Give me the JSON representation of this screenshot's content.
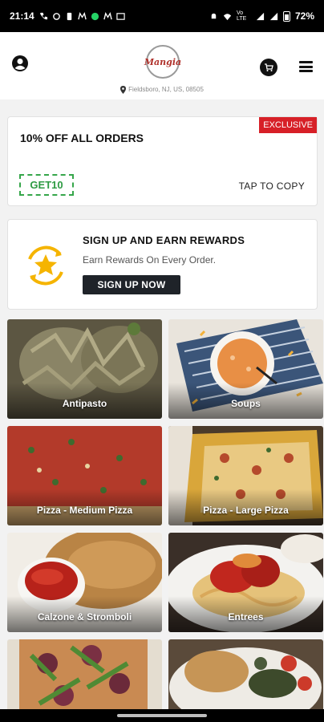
{
  "status_bar": {
    "time": "21:14",
    "battery": "72%",
    "network": "Vo LTE"
  },
  "header": {
    "logo_text": "Mangia",
    "location": "Fieldsboro, NJ, US, 08505"
  },
  "coupon": {
    "title": "10% OFF ALL ORDERS",
    "badge": "EXCLUSIVE",
    "code": "GET10",
    "copy_label": "TAP TO COPY"
  },
  "rewards": {
    "title": "SIGN UP AND EARN REWARDS",
    "subtitle": "Earn Rewards On Every Order.",
    "button_label": "SIGN UP NOW"
  },
  "categories": [
    {
      "label": "Antipasto"
    },
    {
      "label": "Soups"
    },
    {
      "label": "Pizza - Medium Pizza"
    },
    {
      "label": "Pizza - Large Pizza"
    },
    {
      "label": "Calzone & Stromboli"
    },
    {
      "label": "Entrees"
    },
    {
      "label": ""
    },
    {
      "label": ""
    }
  ],
  "colors": {
    "badge_red": "#d72027",
    "code_green": "#2e9b43",
    "button_dark": "#1f2329",
    "reward_yellow": "#f5b400"
  }
}
